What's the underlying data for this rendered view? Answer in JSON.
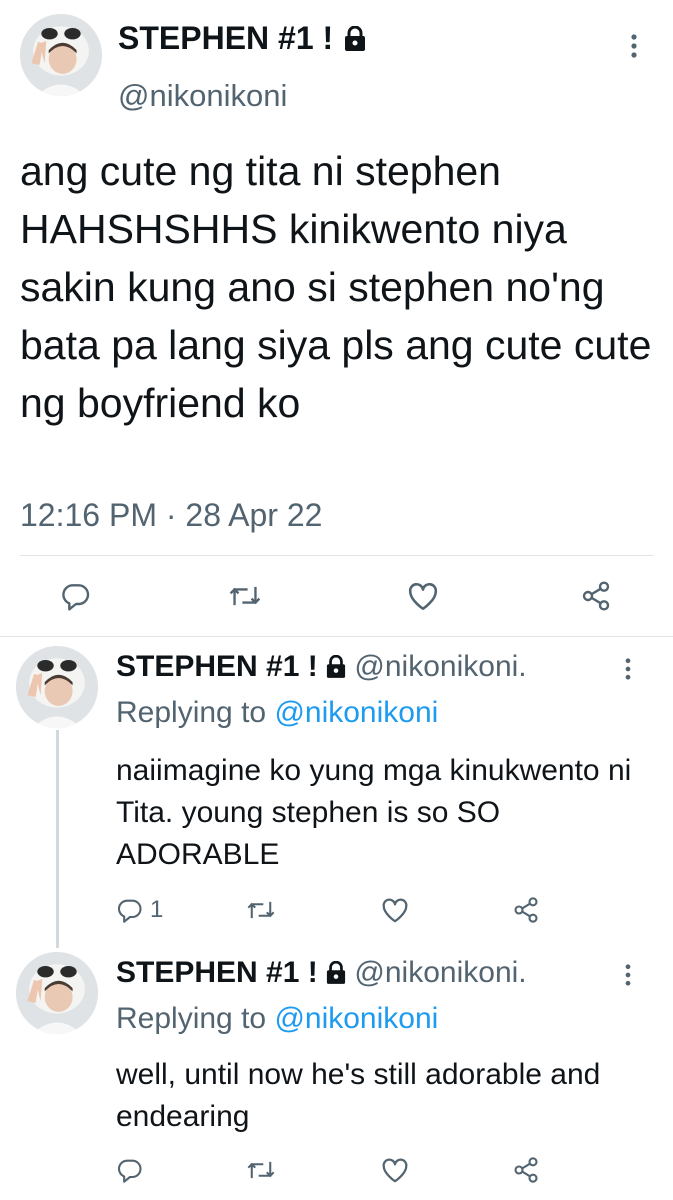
{
  "main_tweet": {
    "display_name": "STEPHEN #1 !",
    "handle": "@nikonikoni",
    "text": "ang cute ng tita ni stephen HAHSHSHHS kinikwento niya sakin kung ano si stephen no'ng bata pa lang siya pls ang cute cute ng boyfriend ko",
    "timestamp": "12:16 PM · 28 Apr 22",
    "icons": [
      "reply-icon",
      "retweet-icon",
      "like-icon",
      "share-icon"
    ]
  },
  "replies": [
    {
      "display_name": "STEPHEN #1 !",
      "handle": "@nikonikoni.",
      "replying_prefix": "Replying to ",
      "replying_to": "@nikonikoni",
      "text": "naiimagine ko yung mga kinukwento ni Tita. young stephen is so SO ADORABLE",
      "reply_count": "1"
    },
    {
      "display_name": "STEPHEN #1 !",
      "handle": "@nikonikoni.",
      "replying_prefix": "Replying to ",
      "replying_to": "@nikonikoni",
      "text": "well, until now he's still adorable and endearing",
      "reply_count": ""
    }
  ],
  "colors": {
    "text_primary": "#0f1419",
    "text_secondary": "#536471",
    "link": "#1d9bf0",
    "divider": "#e1e6ea"
  }
}
